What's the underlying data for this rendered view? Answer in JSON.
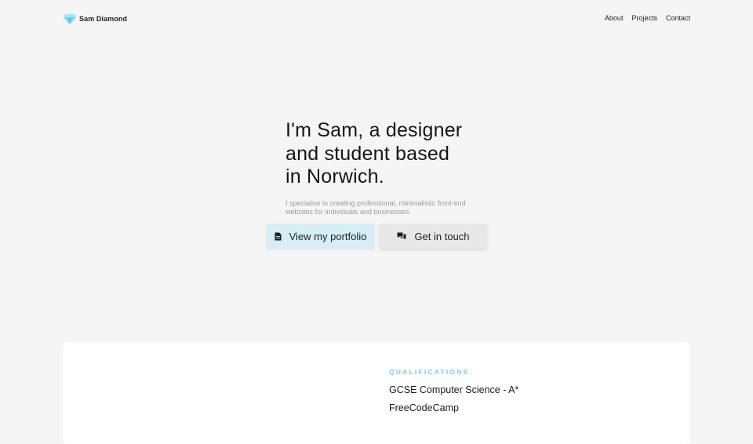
{
  "nav": {
    "brand_name": "Sam Diamond",
    "brand_icon": "diamond-icon",
    "links": [
      {
        "label": "About"
      },
      {
        "label": "Projects"
      },
      {
        "label": "Contact"
      }
    ]
  },
  "hero": {
    "title_lines": [
      "I'm Sam, a designer",
      "and student based",
      "in Norwich."
    ],
    "subtitle_lines": [
      "I specialise in creating professional, minimalistic front-end",
      "websites for individuals and businesses."
    ],
    "portfolio_button": {
      "label": "View my portfolio",
      "icon": "document-icon"
    },
    "contact_button": {
      "label": "Get in touch",
      "icon": "chat-icon"
    }
  },
  "qualifications": {
    "heading": "QUALIFICATIONS",
    "items": [
      "GCSE Computer Science - A*",
      "FreeCodeCamp"
    ]
  },
  "colors": {
    "background": "#f5f5f5",
    "accent": "#6dd0ef",
    "diamond": "#7fd6f2",
    "portfolio_button_bg": "#d6eef7",
    "contact_button_bg": "#e8e8e8",
    "card_bg": "#ffffff"
  }
}
